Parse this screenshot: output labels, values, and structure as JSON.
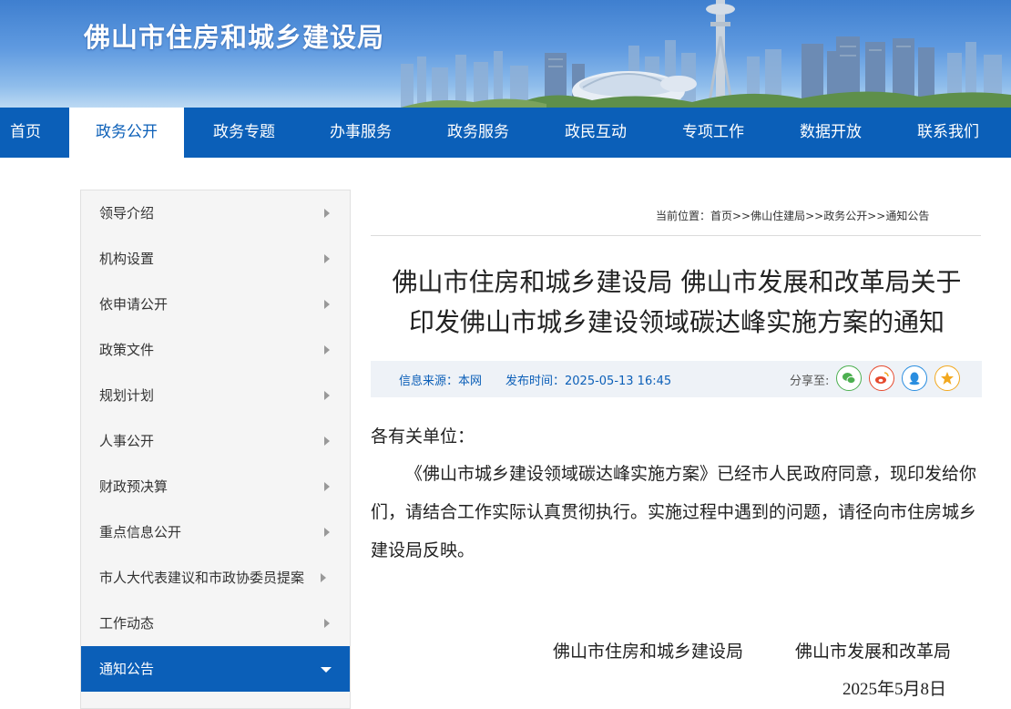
{
  "header": {
    "site_title": "佛山市住房和城乡建设局"
  },
  "nav": {
    "items": [
      "首页",
      "政务公开",
      "政务专题",
      "办事服务",
      "政务服务",
      "政民互动",
      "专项工作",
      "数据开放",
      "联系我们"
    ],
    "active": "政务公开"
  },
  "sidebar": {
    "items": [
      "领导介绍",
      "机构设置",
      "依申请公开",
      "政策文件",
      "规划计划",
      "人事公开",
      "财政预决算",
      "重点信息公开",
      "市人大代表建议和市政协委员提案",
      "工作动态",
      "通知公告"
    ],
    "active": "通知公告"
  },
  "breadcrumb": "当前位置：首页>>佛山住建局>>政务公开>>通知公告",
  "article": {
    "title_line1": "佛山市住房和城乡建设局 佛山市发展和改革局关于",
    "title_line2": "印发佛山市城乡建设领域碳达峰实施方案的通知",
    "source": "信息来源：本网",
    "publish_time": "发布时间：2025-05-13 16:45",
    "share_label": "分享至:",
    "share_icons": [
      "wechat-icon",
      "weibo-icon",
      "qq-icon",
      "qzone-icon"
    ],
    "salutation": "各有关单位：",
    "body": "《佛山市城乡建设领域碳达峰实施方案》已经市人民政府同意，现印发给你们，请结合工作实际认真贯彻执行。实施过程中遇到的问题，请径向市住房城乡建设局反映。",
    "signatory_1": "佛山市住房和城乡建设局",
    "signatory_2": "佛山市发展和改革局",
    "date": "2025年5月8日"
  },
  "colors": {
    "nav_blue": "#0b5fb8",
    "meta_bg": "#eef2f7",
    "wechat": "#4caf50",
    "weibo": "#e6492d",
    "qq": "#2a8ee0",
    "qzone": "#f2a81f"
  }
}
